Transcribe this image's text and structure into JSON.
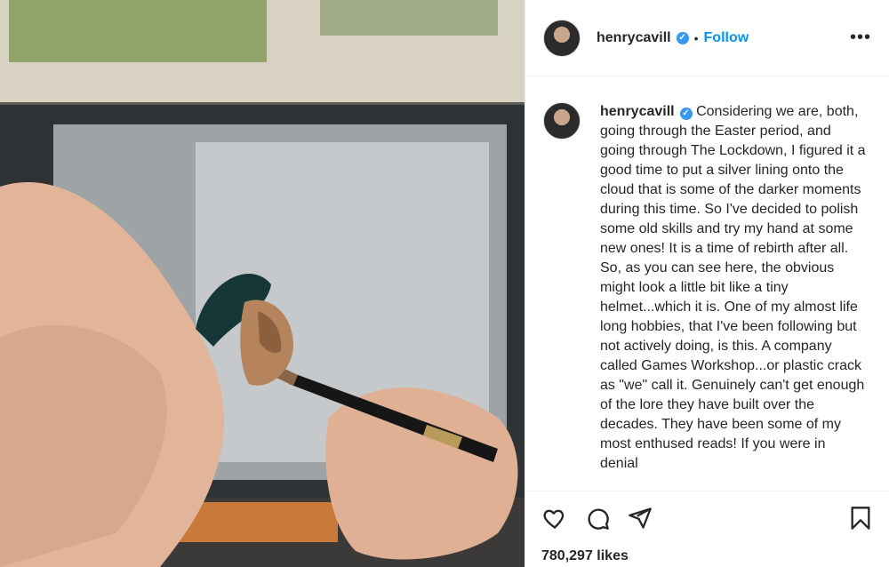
{
  "post": {
    "username": "henrycavill",
    "follow_label": "Follow",
    "separator": "•",
    "more_label": "•••",
    "caption": "Considering we are, both, going through the Easter period, and going through The Lockdown, I figured it a good time to put a silver lining onto the cloud that is some of the darker moments during this time. So I've decided to polish some old skills and try my hand at some new ones! It is a time of rebirth after all. So, as you can see here, the obvious might look a little bit like a tiny helmet...which it is. One of my almost life long hobbies, that I've been following but not actively doing, is this. A company called Games Workshop...or plastic crack as \"we\" call it. Genuinely can't get enough of the lore they have built over the decades. They have been some of my most enthused reads! If you were in denial",
    "likes": "780,297 likes",
    "verified_icon": "verified-badge-icon",
    "accent_color": "#0095f6"
  }
}
